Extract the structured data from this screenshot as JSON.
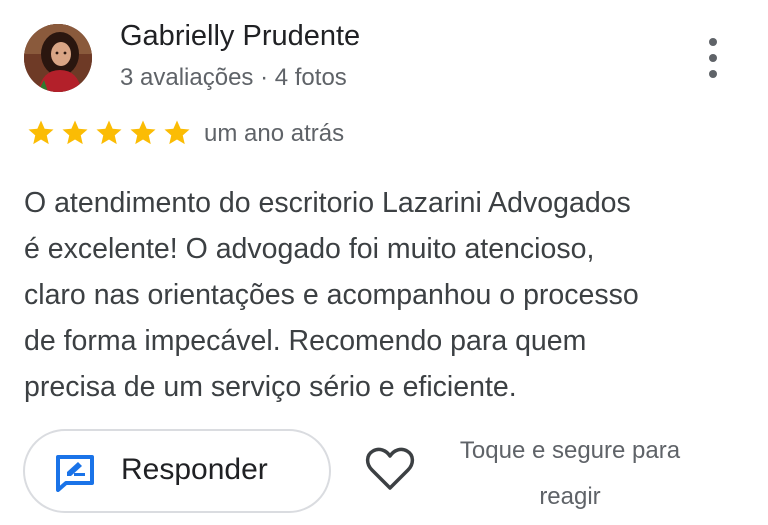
{
  "reviewer": {
    "name": "Gabrielly Prudente",
    "meta": "3 avaliações · 4 fotos",
    "avatar_icon": "profile-photo"
  },
  "rating": {
    "stars": 5,
    "max": 5,
    "color": "#fbbc04"
  },
  "time_ago": "um ano atrás",
  "review_text": "O atendimento do escritorio Lazarini Advogados\né excelente! O advogado foi muito atencioso,\nclaro nas orientações e acompanhou o processo\nde forma impecável. Recomendo para quem\nprecisa de um serviço sério e eficiente.",
  "actions": {
    "reply_label": "Responder",
    "reply_icon": "feedback-icon",
    "react_icon": "heart-outline-icon",
    "react_hint": "Toque e segure para\nreagir"
  },
  "colors": {
    "accent": "#1a73e8",
    "text": "#3c4043",
    "secondary": "#5f6368"
  }
}
